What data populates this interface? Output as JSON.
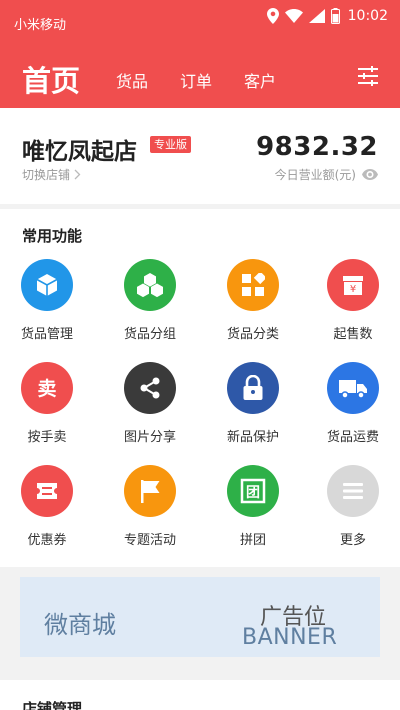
{
  "status_bar": {
    "carrier": "小米移动",
    "time": "10:02"
  },
  "nav": {
    "home": "首页",
    "tabs": [
      "货品",
      "订单",
      "客户"
    ]
  },
  "store": {
    "name": "唯忆凤起店",
    "badge": "专业版",
    "switch_label": "切换店铺",
    "revenue": "9832.32",
    "revenue_label": "今日营业额(元)"
  },
  "functions": {
    "title": "常用功能",
    "items": [
      {
        "label": "货品管理",
        "color": "#2196e8",
        "icon": "cube-icon"
      },
      {
        "label": "货品分组",
        "color": "#2eb048",
        "icon": "boxes-icon"
      },
      {
        "label": "货品分类",
        "color": "#f8960e",
        "icon": "category-icon"
      },
      {
        "label": "起售数",
        "color": "#f04e4e",
        "icon": "yen-box-icon"
      },
      {
        "label": "按手卖",
        "color": "#f04e4e",
        "icon": "sell-icon"
      },
      {
        "label": "图片分享",
        "color": "#3a3a3a",
        "icon": "share-icon"
      },
      {
        "label": "新品保护",
        "color": "#2e58a8",
        "icon": "lock-icon"
      },
      {
        "label": "货品运费",
        "color": "#2c76e4",
        "icon": "truck-icon"
      },
      {
        "label": "优惠券",
        "color": "#f04e4e",
        "icon": "coupon-icon"
      },
      {
        "label": "专题活动",
        "color": "#f8960e",
        "icon": "flag-icon"
      },
      {
        "label": "拼团",
        "color": "#2eb048",
        "icon": "group-buy-icon"
      },
      {
        "label": "更多",
        "color": "#d8d8d8",
        "icon": "more-icon"
      }
    ]
  },
  "banner": {
    "left": "微商城",
    "title": "广告位",
    "subtitle": "BANNER"
  },
  "shop_manage": {
    "title": "店铺管理"
  }
}
